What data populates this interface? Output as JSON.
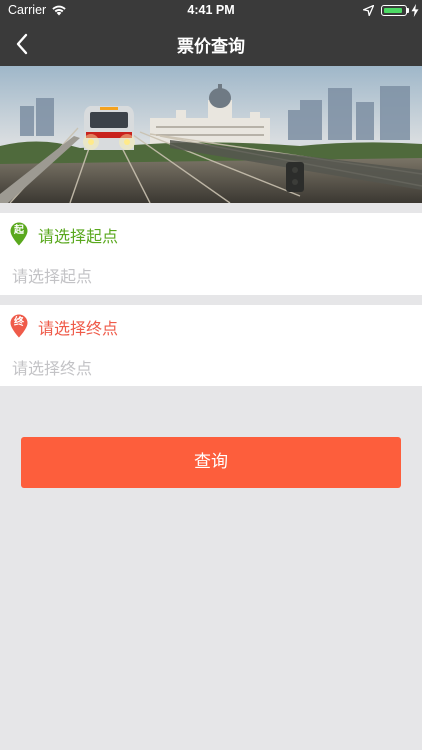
{
  "status_bar": {
    "carrier": "Carrier",
    "time": "4:41 PM",
    "battery_level": 0.9,
    "battery_color": "#4cd964",
    "icons": [
      "wifi-icon",
      "location-arrow-icon",
      "battery-icon",
      "charging-bolt-icon"
    ]
  },
  "nav": {
    "title": "票价查询",
    "back_icon": "chevron-left-icon",
    "background": "#3a3a3a"
  },
  "banner": {
    "description_icon": "train-city-banner-image"
  },
  "start": {
    "pin_char": "起",
    "label": "请选择起点",
    "placeholder": "请选择起点",
    "value": "",
    "color": "#5aa81e"
  },
  "end": {
    "pin_char": "终",
    "label": "请选择终点",
    "placeholder": "请选择终点",
    "value": "",
    "color": "#ef5b4a"
  },
  "query_button": {
    "label": "查询",
    "color": "#fd5e3c"
  }
}
